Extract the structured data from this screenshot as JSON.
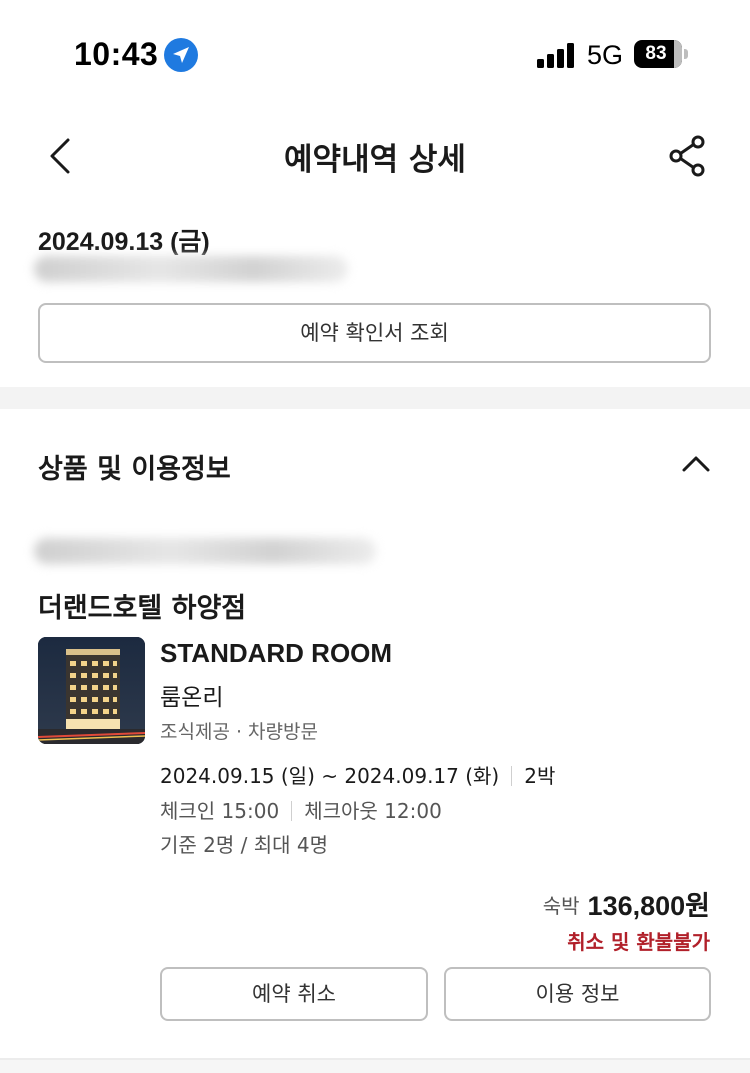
{
  "status_bar": {
    "time": "10:43",
    "network": "5G",
    "battery_percent": "83",
    "battery_level": 0.83,
    "location_icon": "location-arrow-icon",
    "signal_icon": "cellular-signal-icon"
  },
  "header": {
    "title": "예약내역 상세",
    "back_icon": "chevron-left-icon",
    "share_icon": "share-icon"
  },
  "order": {
    "date": "2024.09.13 (금)",
    "confirmation_button": "예약 확인서 조회"
  },
  "section": {
    "title": "상품 및 이용정보",
    "toggle_icon": "chevron-up-icon"
  },
  "booking": {
    "hotel_name": "더랜드호텔 하양점",
    "room_name": "STANDARD ROOM",
    "room_type": "룸온리",
    "options": "조식제공 · 차량방문",
    "checkin_date": "2024.09.15 (일)",
    "date_separator": "~",
    "checkout_date": "2024.09.17 (화)",
    "nights": "2박",
    "checkin_time": "체크인 15:00",
    "checkout_time": "체크아웃 12:00",
    "occupancy": "기준 2명 / 최대 4명",
    "price_label": "숙박",
    "price": "136,800원",
    "refund_policy": "취소 및 환불불가",
    "cancel_button": "예약 취소",
    "info_button": "이용 정보"
  },
  "colors": {
    "accent_blue": "#1f7ae0",
    "refund_red": "#b1202a",
    "border_gray": "#bfbfbf",
    "section_gap": "#f3f3f3"
  }
}
